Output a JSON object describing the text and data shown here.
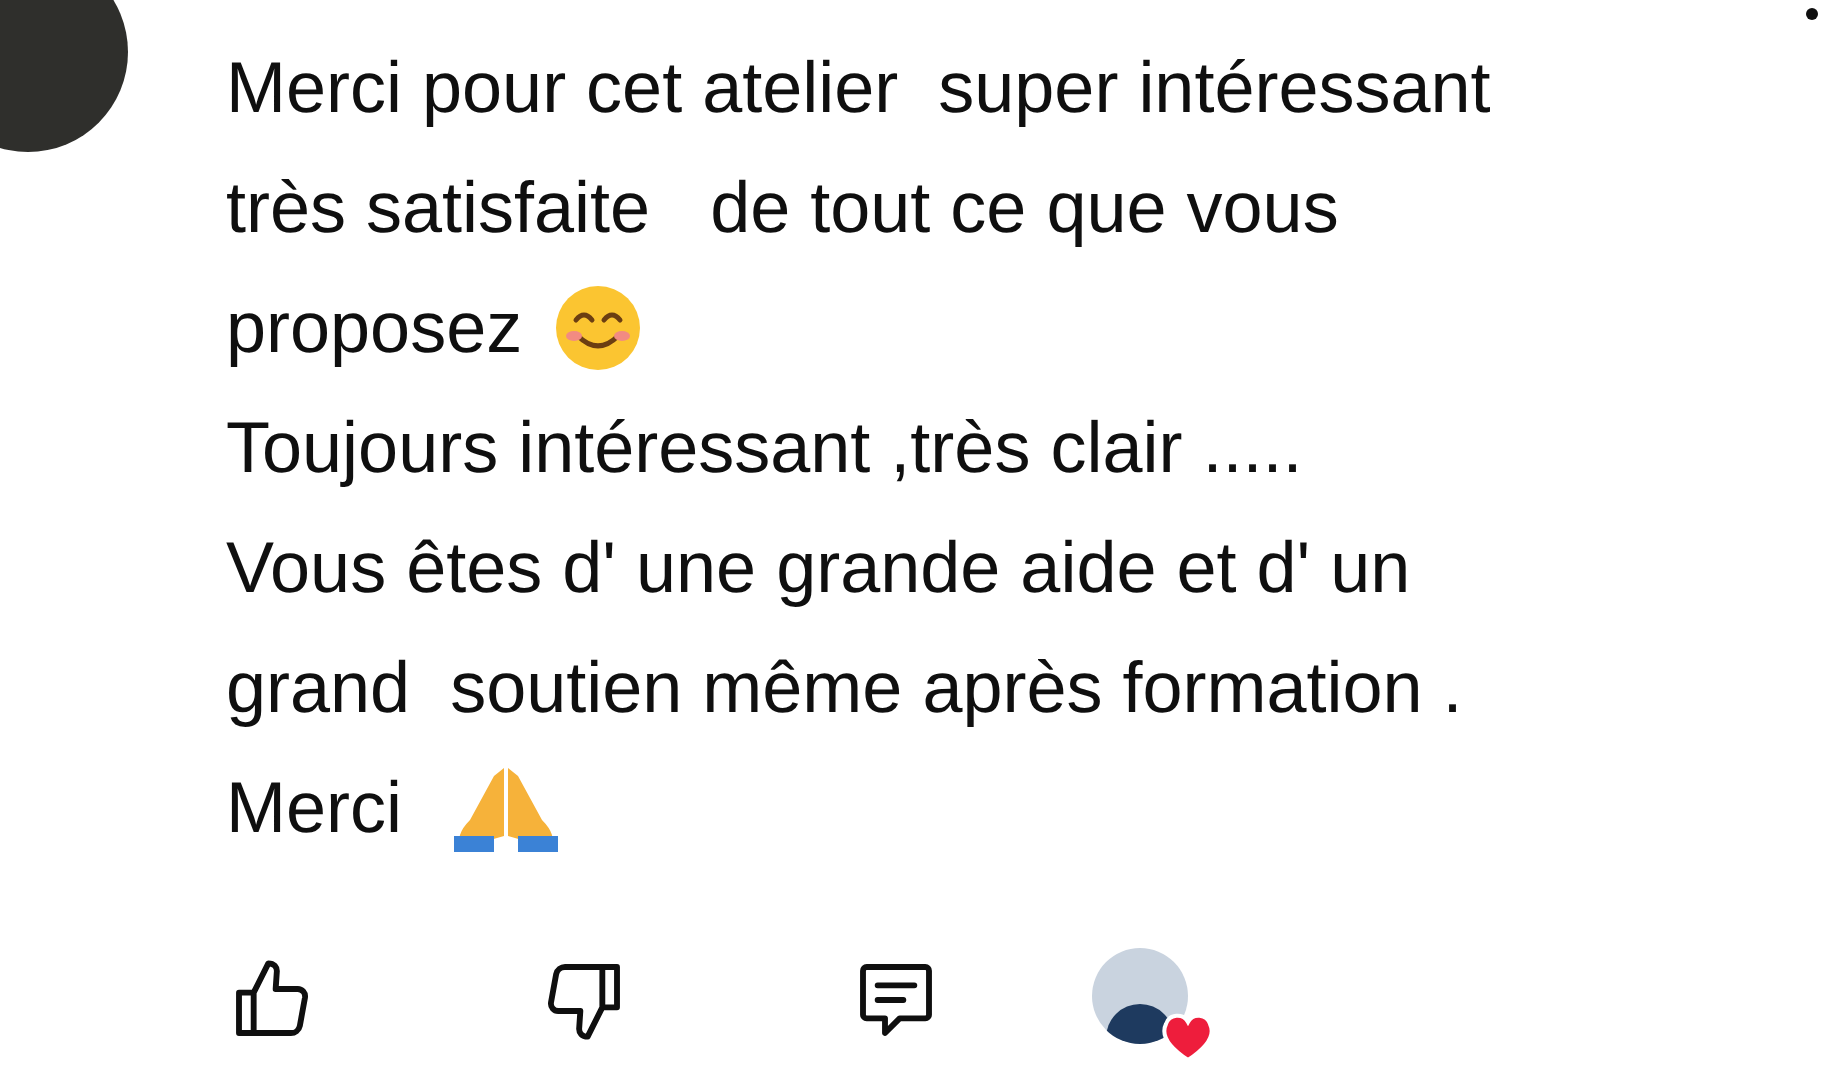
{
  "comment": {
    "lines": [
      {
        "kind": "plain",
        "text": "Merci pour cet atelier  super intéressant"
      },
      {
        "kind": "plain",
        "text": "très satisfaite   de tout ce que vous"
      },
      {
        "kind": "smile",
        "text": "proposez"
      },
      {
        "kind": "plain",
        "text": "Toujours intéressant ,très clair ....."
      },
      {
        "kind": "plain",
        "text": "Vous êtes d' une grande aide et d' un"
      },
      {
        "kind": "plain",
        "text": "grand  soutien même après formation ."
      },
      {
        "kind": "pray",
        "text": "Merci"
      }
    ],
    "creator_hearted": true
  }
}
